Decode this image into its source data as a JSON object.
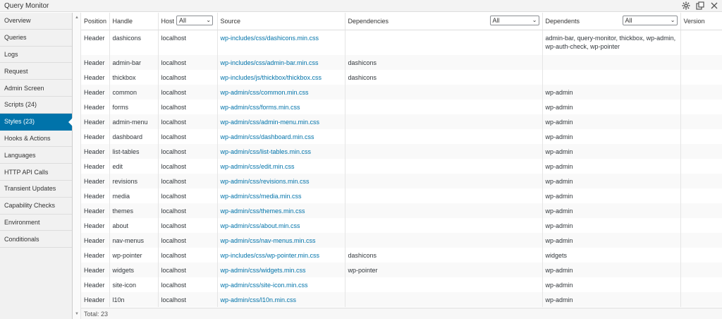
{
  "window": {
    "title": "Query Monitor"
  },
  "sidebar": {
    "items": [
      {
        "label": "Overview"
      },
      {
        "label": "Queries"
      },
      {
        "label": "Logs"
      },
      {
        "label": "Request"
      },
      {
        "label": "Admin Screen"
      },
      {
        "label": "Scripts (24)"
      },
      {
        "label": "Styles (23)",
        "active": true
      },
      {
        "label": "Hooks & Actions"
      },
      {
        "label": "Languages"
      },
      {
        "label": "HTTP API Calls"
      },
      {
        "label": "Transient Updates"
      },
      {
        "label": "Capability Checks"
      },
      {
        "label": "Environment"
      },
      {
        "label": "Conditionals"
      }
    ]
  },
  "table": {
    "headers": {
      "position": "Position",
      "handle": "Handle",
      "host": "Host",
      "host_filter": "All",
      "source": "Source",
      "dependencies": "Dependencies",
      "dependencies_filter": "All",
      "dependents": "Dependents",
      "dependents_filter": "All",
      "version": "Version"
    },
    "rows": [
      {
        "position": "Header",
        "handle": "dashicons",
        "host": "localhost",
        "source": "wp-includes/css/dashicons.min.css",
        "dependencies": "",
        "dependents": "admin-bar, query-monitor, thickbox, wp-admin, wp-auth-check, wp-pointer",
        "version": ""
      },
      {
        "position": "Header",
        "handle": "admin-bar",
        "host": "localhost",
        "source": "wp-includes/css/admin-bar.min.css",
        "dependencies": "dashicons",
        "dependents": "",
        "version": ""
      },
      {
        "position": "Header",
        "handle": "thickbox",
        "host": "localhost",
        "source": "wp-includes/js/thickbox/thickbox.css",
        "dependencies": "dashicons",
        "dependents": "",
        "version": ""
      },
      {
        "position": "Header",
        "handle": "common",
        "host": "localhost",
        "source": "wp-admin/css/common.min.css",
        "dependencies": "",
        "dependents": "wp-admin",
        "version": ""
      },
      {
        "position": "Header",
        "handle": "forms",
        "host": "localhost",
        "source": "wp-admin/css/forms.min.css",
        "dependencies": "",
        "dependents": "wp-admin",
        "version": ""
      },
      {
        "position": "Header",
        "handle": "admin-menu",
        "host": "localhost",
        "source": "wp-admin/css/admin-menu.min.css",
        "dependencies": "",
        "dependents": "wp-admin",
        "version": ""
      },
      {
        "position": "Header",
        "handle": "dashboard",
        "host": "localhost",
        "source": "wp-admin/css/dashboard.min.css",
        "dependencies": "",
        "dependents": "wp-admin",
        "version": ""
      },
      {
        "position": "Header",
        "handle": "list-tables",
        "host": "localhost",
        "source": "wp-admin/css/list-tables.min.css",
        "dependencies": "",
        "dependents": "wp-admin",
        "version": ""
      },
      {
        "position": "Header",
        "handle": "edit",
        "host": "localhost",
        "source": "wp-admin/css/edit.min.css",
        "dependencies": "",
        "dependents": "wp-admin",
        "version": ""
      },
      {
        "position": "Header",
        "handle": "revisions",
        "host": "localhost",
        "source": "wp-admin/css/revisions.min.css",
        "dependencies": "",
        "dependents": "wp-admin",
        "version": ""
      },
      {
        "position": "Header",
        "handle": "media",
        "host": "localhost",
        "source": "wp-admin/css/media.min.css",
        "dependencies": "",
        "dependents": "wp-admin",
        "version": ""
      },
      {
        "position": "Header",
        "handle": "themes",
        "host": "localhost",
        "source": "wp-admin/css/themes.min.css",
        "dependencies": "",
        "dependents": "wp-admin",
        "version": ""
      },
      {
        "position": "Header",
        "handle": "about",
        "host": "localhost",
        "source": "wp-admin/css/about.min.css",
        "dependencies": "",
        "dependents": "wp-admin",
        "version": ""
      },
      {
        "position": "Header",
        "handle": "nav-menus",
        "host": "localhost",
        "source": "wp-admin/css/nav-menus.min.css",
        "dependencies": "",
        "dependents": "wp-admin",
        "version": ""
      },
      {
        "position": "Header",
        "handle": "wp-pointer",
        "host": "localhost",
        "source": "wp-includes/css/wp-pointer.min.css",
        "dependencies": "dashicons",
        "dependents": "widgets",
        "version": ""
      },
      {
        "position": "Header",
        "handle": "widgets",
        "host": "localhost",
        "source": "wp-admin/css/widgets.min.css",
        "dependencies": "wp-pointer",
        "dependents": "wp-admin",
        "version": ""
      },
      {
        "position": "Header",
        "handle": "site-icon",
        "host": "localhost",
        "source": "wp-admin/css/site-icon.min.css",
        "dependencies": "",
        "dependents": "wp-admin",
        "version": ""
      },
      {
        "position": "Header",
        "handle": "l10n",
        "host": "localhost",
        "source": "wp-admin/css/l10n.min.css",
        "dependencies": "",
        "dependents": "wp-admin",
        "version": ""
      }
    ],
    "footer": "Total: 23"
  },
  "icons": {
    "settings": "gear-icon",
    "popout": "popout-icon",
    "close": "close-icon"
  }
}
